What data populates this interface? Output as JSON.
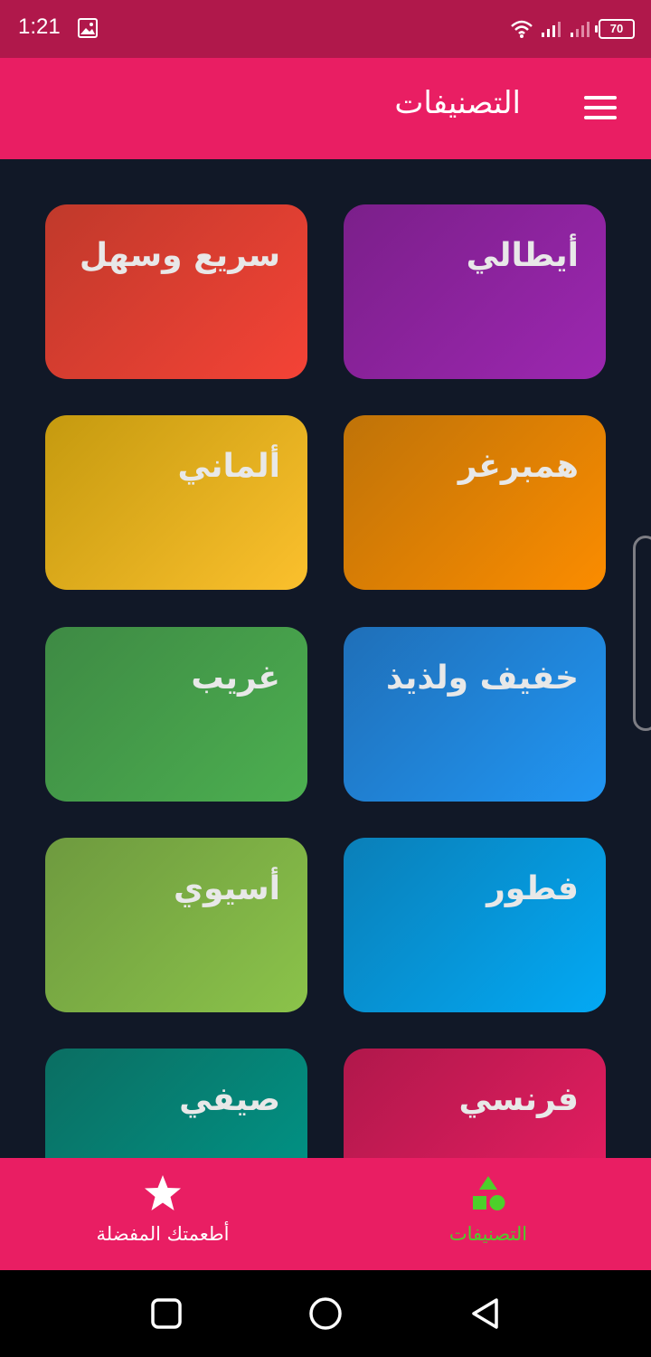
{
  "status_bar": {
    "time": "1:21",
    "battery": "70",
    "icons": [
      "image-icon",
      "wifi-icon",
      "signal-icon",
      "signal-icon",
      "battery-icon"
    ]
  },
  "app_bar": {
    "title": "التصنيفات",
    "menu_icon": "hamburger-menu-icon"
  },
  "categories": [
    {
      "label": "أيطالي",
      "colors": [
        "#7b1f8a",
        "#9c27b0"
      ]
    },
    {
      "label": "سريع وسهل",
      "colors": [
        "#c0392b",
        "#f44336"
      ]
    },
    {
      "label": "همبرغر",
      "colors": [
        "#bf7308",
        "#fb8c00"
      ]
    },
    {
      "label": "ألماني",
      "colors": [
        "#c59a0f",
        "#fbc02d"
      ]
    },
    {
      "label": "خفيف ولذيذ",
      "colors": [
        "#1f6fb8",
        "#2196f3"
      ]
    },
    {
      "label": "غريب",
      "colors": [
        "#3e8a44",
        "#4caf50"
      ]
    },
    {
      "label": "فطور",
      "colors": [
        "#0a7fb8",
        "#03a9f4"
      ]
    },
    {
      "label": "أسيوي",
      "colors": [
        "#6e9a3f",
        "#8bc34a"
      ]
    },
    {
      "label": "فرنسي",
      "colors": [
        "#b0184b",
        "#e91e63"
      ]
    },
    {
      "label": "صيفي",
      "colors": [
        "#0b6e62",
        "#009688"
      ]
    }
  ],
  "bottom_nav": {
    "items": [
      {
        "label": "أطعمتك المفضلة",
        "icon": "star-icon",
        "active": false
      },
      {
        "label": "التصنيفات",
        "icon": "shapes-icon",
        "active": true
      }
    ],
    "active_color": "#4cd02a",
    "inactive_color": "#ffffff"
  },
  "system_nav": {
    "buttons": [
      "recents-square-icon",
      "home-circle-icon",
      "back-triangle-icon"
    ]
  }
}
